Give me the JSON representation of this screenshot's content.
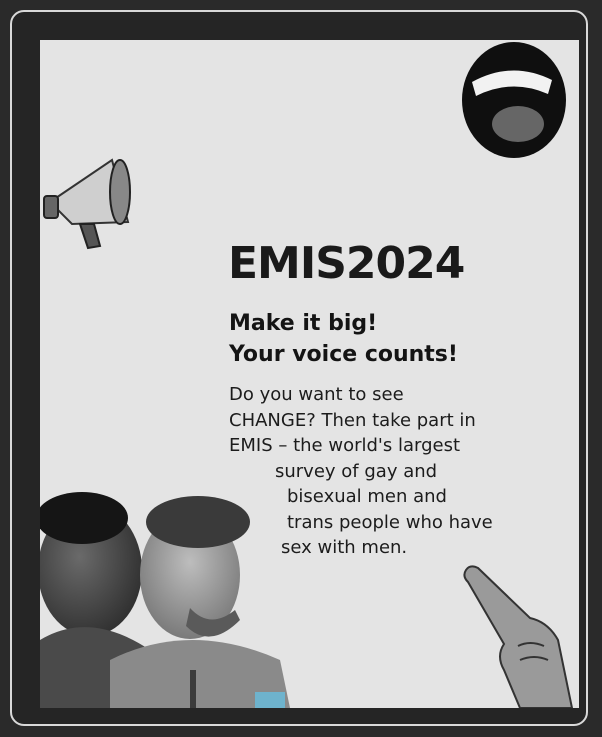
{
  "poster": {
    "title": "EMIS2024",
    "headline": [
      "Make it big!",
      "Your voice counts!"
    ],
    "body_lines": [
      "Do you want to see",
      "CHANGE? Then take part in",
      "EMIS – the world's largest",
      "survey of gay and",
      "bisexual men and",
      "trans people who have",
      "sex with men."
    ],
    "colors": {
      "background": "#e4e4e4",
      "frame_border": "#d9d9d9",
      "pride_stripes": [
        "#e53935",
        "#f39c12",
        "#f2e600",
        "#3fa535",
        "#2c5fb5",
        "#7b3fa0"
      ],
      "progress_stripes": [
        "#5bcefa",
        "#f5a9b8",
        "#ffffff",
        "#7b4a2a",
        "#1a1a1a"
      ]
    },
    "icons": [
      "megaphone-icon",
      "open-mouth-illustration",
      "pointing-hand-illustration",
      "couple-photo"
    ]
  }
}
